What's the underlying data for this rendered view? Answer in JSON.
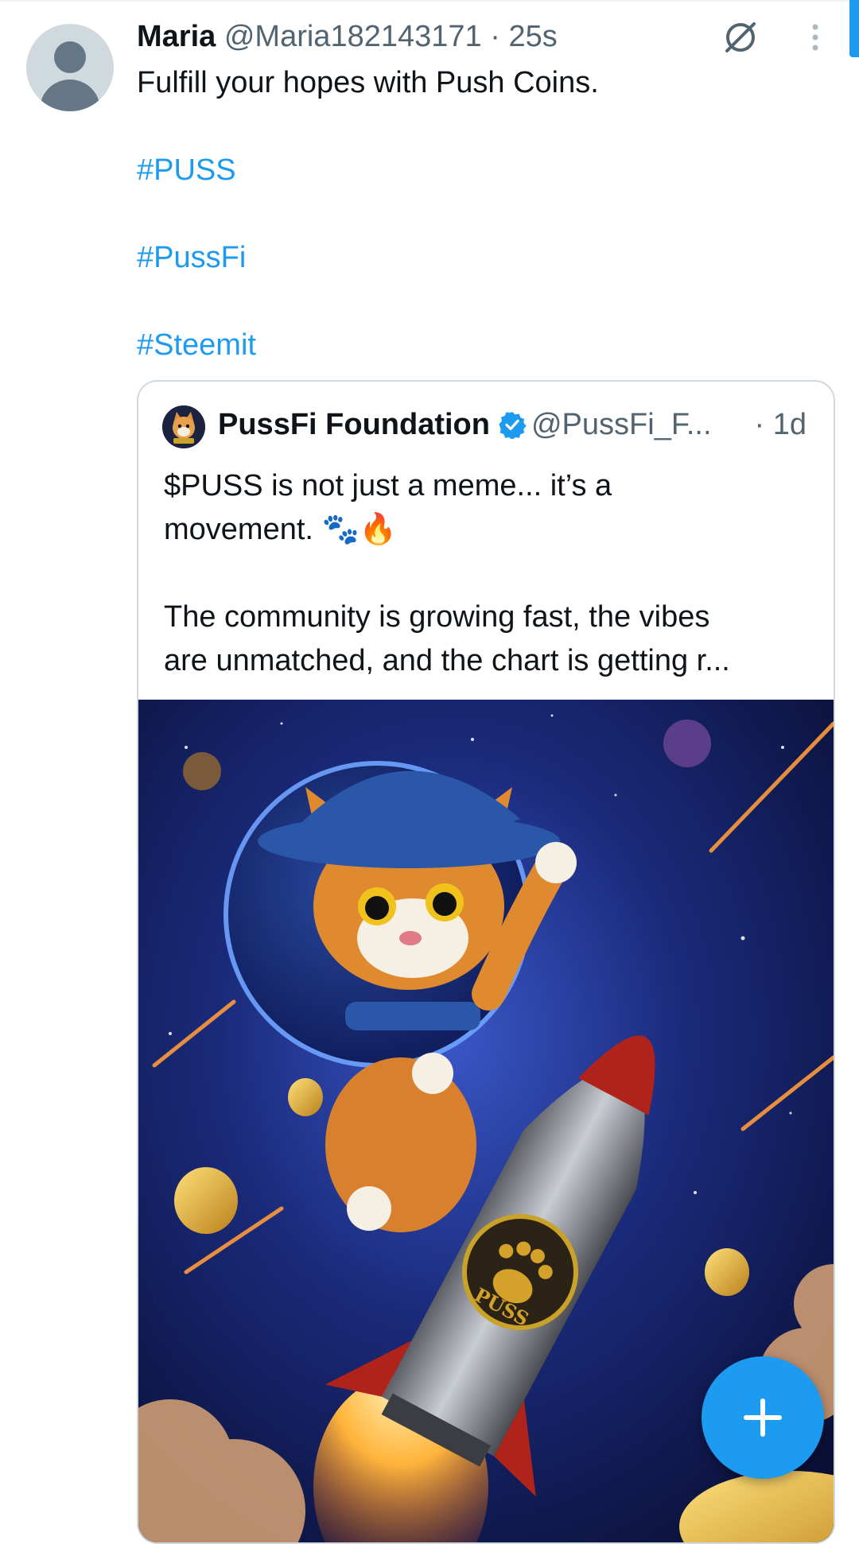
{
  "post": {
    "author_name": "Maria",
    "handle": "@Maria182143171",
    "separator": "·",
    "time": "25s",
    "text": "Fulfill your hopes with Push Coins.",
    "hashtags": [
      "#PUSS",
      "#PussFi",
      "#Steemit"
    ],
    "icons": {
      "avatar": "default-avatar-icon",
      "action": "no-entry-icon",
      "menu": "more-vertical-icon"
    }
  },
  "quote": {
    "author_name": "PussFi Foundation",
    "handle": "@PussFi_F...",
    "time": "· 1d",
    "lines": [
      "$PUSS is not just a meme... it’s a",
      "movement. 🐾🔥",
      "",
      "The community is growing fast, the vibes",
      "are unmatched, and the chart is getting r..."
    ],
    "verified_color": "#1d9bf0",
    "media_badge_text": "PUSS"
  },
  "fab": {
    "icon": "plus-icon"
  },
  "colors": {
    "accent": "#1d9bf0",
    "text": "#0f1419",
    "secondary": "#536471",
    "border": "#cfd9de"
  }
}
